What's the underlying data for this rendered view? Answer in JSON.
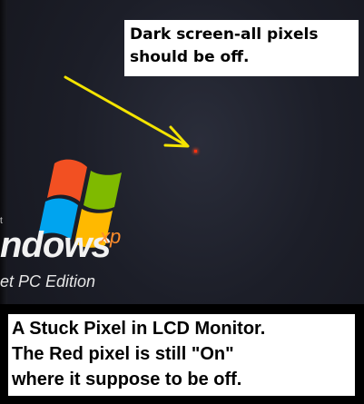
{
  "annotations": {
    "top_note": "Dark screen-all pixels\nshould be off.",
    "bottom_note": "A Stuck Pixel in LCD Monitor.\nThe Red pixel is still \"On\"\nwhere it suppose to be off."
  },
  "logo": {
    "fragment": "t",
    "word": "ndows",
    "superscript": "xp",
    "edition": "et PC Edition"
  },
  "colors": {
    "arrow": "#f4e400",
    "stuck_pixel": "#ff3010",
    "screen_background": "#1c1e28",
    "xp_accent": "#ff8c2a"
  }
}
